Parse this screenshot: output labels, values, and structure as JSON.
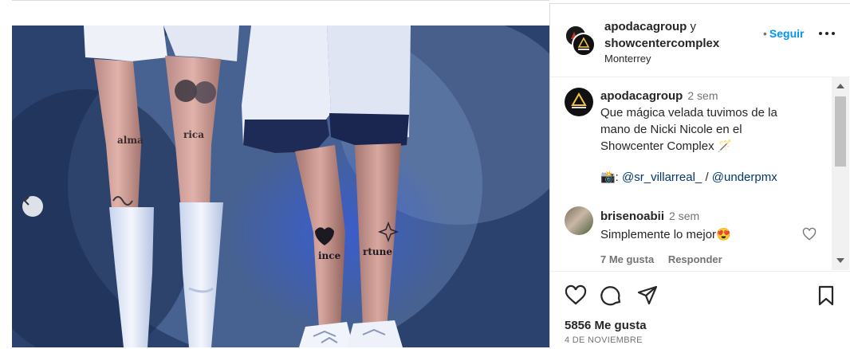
{
  "post": {
    "author_1": "apodacagroup",
    "joiner": "y",
    "author_2": "showcentercomplex",
    "location": "Monterrey",
    "follow_dot": "•",
    "follow_label": "Seguir"
  },
  "caption": {
    "username": "apodacagroup",
    "time": "2 sem",
    "text": "Que mágica velada tuvimos de la mano de Nicki Nicole en el Showcenter Complex 🪄",
    "credit_prefix": "📸: ",
    "credit_user_1": "@sr_villarreal_",
    "credit_sep": " / ",
    "credit_user_2": "@underpmx"
  },
  "comment": {
    "username": "brisenoabii",
    "time": "2 sem",
    "text": "Simplemente lo mejor😍",
    "likes": "7 Me gusta",
    "reply": "Responder"
  },
  "stats": {
    "likes": "5856 Me gusta",
    "date": "4 DE NOVIEMBRE"
  },
  "photo": {
    "tattoo_left_1": "alma",
    "tattoo_left_2": "rica",
    "tattoo_right_1": "ince",
    "tattoo_right_2": "rtune"
  },
  "icons": {
    "prev": "chevron-left-icon",
    "like": "heart-icon",
    "comment": "comment-icon",
    "share": "paper-plane-icon",
    "save": "bookmark-icon",
    "more": "more-horizontal-icon"
  },
  "colors": {
    "accent": "#0095f6",
    "link": "#00376b",
    "muted": "#737373"
  }
}
